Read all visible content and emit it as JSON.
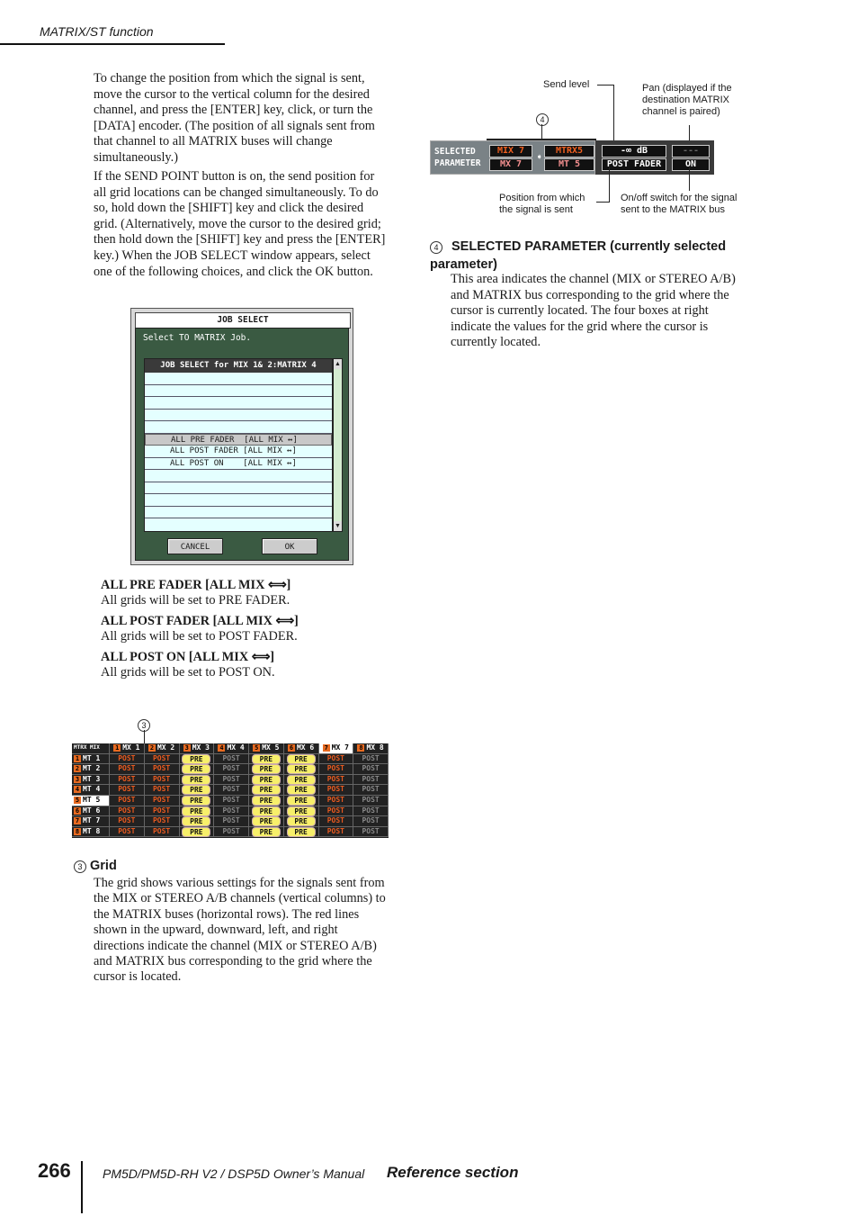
{
  "header": {
    "section_title": "MATRIX/ST function"
  },
  "intro": {
    "para1": "To change the position from which the signal is sent, move the cursor to the vertical column for the desired channel, and press the [ENTER] key, click, or turn the [DATA] encoder. (The position of all signals sent from that channel to all MATRIX buses will change simultaneously.)",
    "para2": "If the SEND POINT button is on, the send position for all grid locations can be changed simultaneously. To do so, hold down the [SHIFT] key and click the desired grid. (Alternatively, move the cursor to the desired grid; then hold down the [SHIFT] key and press the [ENTER] key.) When the JOB SELECT window appears, select one of the following choices, and click the OK button."
  },
  "job_select_window": {
    "title": "JOB SELECT",
    "message": "Select TO MATRIX Job.",
    "list_header": "JOB SELECT for MIX 1& 2:MATRIX 4",
    "items": [
      "",
      "",
      "",
      "",
      "",
      "ALL PRE FADER  [ALL MIX ↔]",
      "ALL POST FADER [ALL MIX ↔]",
      "ALL POST ON    [ALL MIX ↔]",
      "",
      "",
      "",
      ""
    ],
    "selected_index": 5,
    "cancel_label": "CANCEL",
    "ok_label": "OK"
  },
  "options": [
    {
      "title": "ALL PRE FADER [ALL MIX ⟺]",
      "desc": "All grids will be set to PRE FADER."
    },
    {
      "title": "ALL POST FADER [ALL MIX ⟺]",
      "desc": "All grids will be set to POST FADER."
    },
    {
      "title": "ALL POST ON [ALL MIX ⟺]",
      "desc": "All grids will be set to POST ON."
    }
  ],
  "grid": {
    "callout": "3",
    "corner_top": "MIX",
    "corner_bottom": "MTRX",
    "columns": [
      "MX 1",
      "MX 2",
      "MX 3",
      "MX 4",
      "MX 5",
      "MX 6",
      "MX 7",
      "MX 8"
    ],
    "rows": [
      "MT 1",
      "MT 2",
      "MT 3",
      "MT 4",
      "MT 5",
      "MT 6",
      "MT 7",
      "MT 8"
    ],
    "column_values": [
      "POST",
      "POST",
      "PRE",
      "POST",
      "PRE",
      "PRE",
      "POST",
      "POST"
    ],
    "column_styles": [
      "post-r",
      "post-r",
      "pre",
      "post-g",
      "pre",
      "pre",
      "post-r",
      "post-g"
    ],
    "highlight_row": 4,
    "highlight_column": 6
  },
  "grid_section": {
    "number": "3",
    "title": "Grid",
    "body": "The grid shows various settings for the signals sent from the MIX or STEREO A/B channels (vertical columns) to the MATRIX buses (horizontal rows). The red lines shown in the upward, downward, left, and right directions indicate the channel (MIX or STEREO A/B) and MATRIX bus corresponding to the grid where the cursor is located."
  },
  "selected_parameter_panel": {
    "callout": "4",
    "label_line1": "SELECTED",
    "label_line2": "PARAMETER",
    "source_top": "MIX 7",
    "source_bottom": "MX 7",
    "dest_top": "MTRX5",
    "dest_bottom": "MT 5",
    "send_level": "-∞ dB",
    "pan": "---",
    "position": "POST FADER",
    "on_off": "ON",
    "callouts": {
      "send_level": "Send level",
      "pan": "Pan (displayed if the destination MATRIX channel is paired)",
      "position": "Position from which the signal is sent",
      "on_off": "On/off switch for the signal sent to the MATRIX bus"
    }
  },
  "selected_param_section": {
    "number": "4",
    "title": "SELECTED PARAMETER (currently selected parameter)",
    "body": "This area indicates the channel (MIX or STEREO A/B) and MATRIX bus corresponding to the grid where the cursor is currently located. The four boxes at right indicate the values for the grid where the cursor is currently located."
  },
  "footer": {
    "page_number": "266",
    "manual": "PM5D/PM5D-RH V2 / DSP5D Owner’s Manual",
    "section": "Reference section"
  }
}
